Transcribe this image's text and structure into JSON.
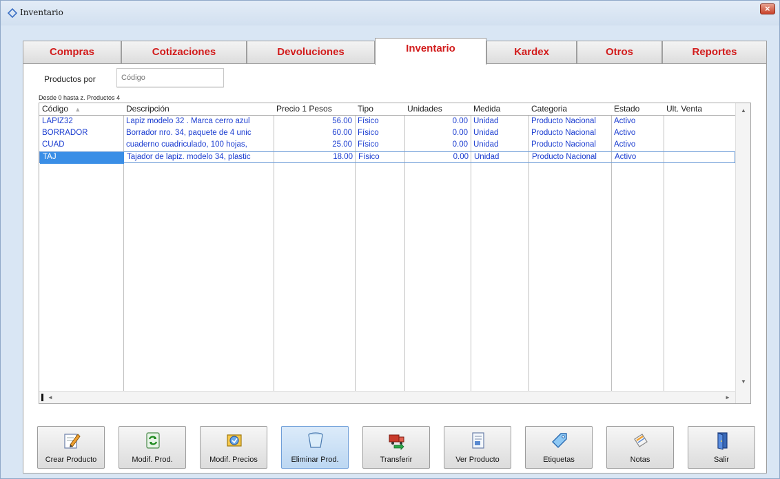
{
  "window": {
    "title": "Inventario"
  },
  "tabs": [
    {
      "label": "Compras"
    },
    {
      "label": "Cotizaciones"
    },
    {
      "label": "Devoluciones"
    },
    {
      "label": "Inventario"
    },
    {
      "label": "Kardex"
    },
    {
      "label": "Otros"
    },
    {
      "label": "Reportes"
    }
  ],
  "active_tab": "Inventario",
  "search": {
    "label": "Productos por",
    "placeholder": "Código"
  },
  "grid": {
    "range_text": "Desde 0 hasta z. Productos 4",
    "columns": [
      "Código",
      "Descripción",
      "Precio 1 Pesos",
      "Tipo",
      "Unidades",
      "Medida",
      "Categoria",
      "Estado",
      "Ult. Venta"
    ],
    "rows": [
      {
        "codigo": "LAPIZ32",
        "descripcion": "Lapiz modelo 32 . Marca cerro azul",
        "precio": "56.00",
        "tipo": "Físico",
        "unidades": "0.00",
        "medida": "Unidad",
        "categoria": "Producto Nacional",
        "estado": "Activo",
        "ult_venta": ""
      },
      {
        "codigo": "BORRADOR",
        "descripcion": "Borrador nro. 34, paquete de 4 unic",
        "precio": "60.00",
        "tipo": "Físico",
        "unidades": "0.00",
        "medida": "Unidad",
        "categoria": "Producto Nacional",
        "estado": "Activo",
        "ult_venta": ""
      },
      {
        "codigo": "CUAD",
        "descripcion": "cuaderno cuadriculado, 100 hojas,",
        "precio": "25.00",
        "tipo": "Físico",
        "unidades": "0.00",
        "medida": "Unidad",
        "categoria": "Producto Nacional",
        "estado": "Activo",
        "ult_venta": ""
      },
      {
        "codigo": "TAJ",
        "descripcion": "Tajador de lapiz. modelo 34, plastic",
        "precio": "18.00",
        "tipo": "Físico",
        "unidades": "0.00",
        "medida": "Unidad",
        "categoria": "Producto Nacional",
        "estado": "Activo",
        "ult_venta": ""
      }
    ],
    "selected_row": 3
  },
  "toolbar": {
    "buttons": [
      {
        "label": "Crear Producto",
        "icon": "pencil-edit-icon"
      },
      {
        "label": "Modif. Prod.",
        "icon": "refresh-icon"
      },
      {
        "label": "Modif. Precios",
        "icon": "price-tag-icon"
      },
      {
        "label": "Eliminar Prod.",
        "icon": "trash-bin-icon"
      },
      {
        "label": "Transferir",
        "icon": "truck-transfer-icon"
      },
      {
        "label": "Ver Producto",
        "icon": "view-document-icon"
      },
      {
        "label": "Etiquetas",
        "icon": "label-tag-icon"
      },
      {
        "label": "Notas",
        "icon": "notes-icon"
      },
      {
        "label": "Salir",
        "icon": "exit-door-icon"
      }
    ]
  },
  "colors": {
    "tab_text": "#d21c1c",
    "row_text": "#1a3cd0",
    "selection": "#3a8ee6",
    "window_bg": "#d9e6f4"
  }
}
